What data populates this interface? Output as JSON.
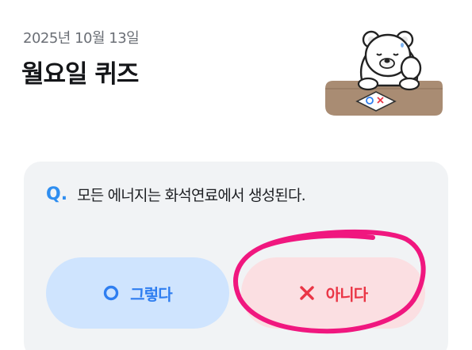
{
  "header": {
    "date": "2025년 10월 13일",
    "title": "월요일 퀴즈"
  },
  "mascot": {
    "icon": "bear-mascot-icon",
    "paper_symbols": "O X"
  },
  "quiz": {
    "question_marker": "Q.",
    "question_text": "모든 에너지는 화석연료에서 생성된다."
  },
  "answers": {
    "yes_label": "그렇다",
    "no_label": "아니다",
    "yes_icon": "circle-o-icon",
    "no_icon": "x-cross-icon"
  },
  "colors": {
    "accent_blue": "#2f7ef0",
    "accent_red": "#ea3646",
    "yes_bg": "#cfe4fe",
    "no_bg": "#fbdfe2",
    "card_bg": "#f1f3f5",
    "annotation": "#f0177f"
  },
  "annotation": {
    "type": "hand-drawn circle",
    "target": "no-answer-button"
  }
}
